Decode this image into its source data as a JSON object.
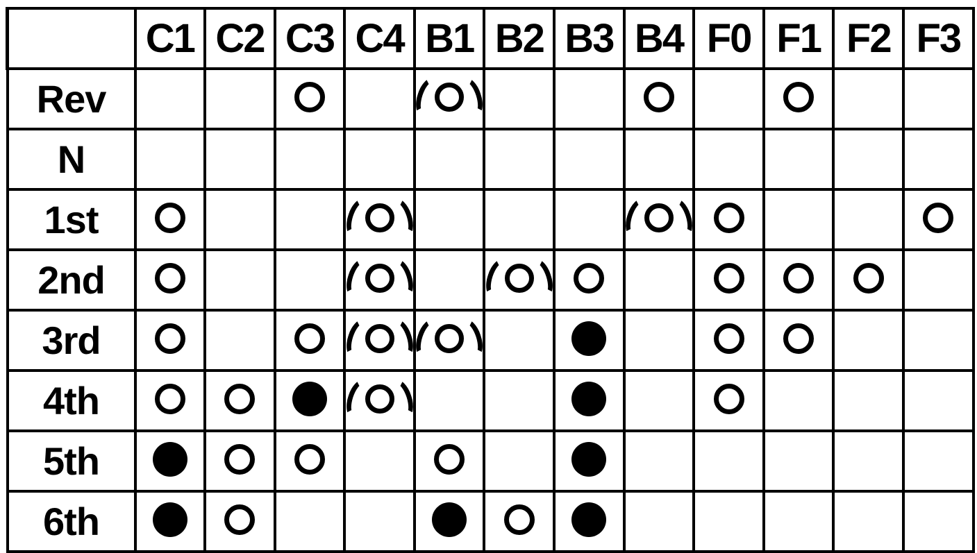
{
  "table": {
    "corner_label": "",
    "columns": [
      "C1",
      "C2",
      "C3",
      "C4",
      "B1",
      "B2",
      "B3",
      "B4",
      "F0",
      "F1",
      "F2",
      "F3"
    ],
    "row_labels": [
      "Rev",
      "N",
      "1st",
      "2nd",
      "3rd",
      "4th",
      "5th",
      "6th"
    ],
    "marker_legend": {
      "open": "open-circle",
      "filled": "filled-circle",
      "paren": "parenthesized-open-circle",
      "empty": "blank"
    },
    "colors": {
      "line": "#000000",
      "background": "#ffffff",
      "text": "#000000"
    },
    "rows": [
      {
        "label": "Rev",
        "cells": [
          "empty",
          "empty",
          "open",
          "empty",
          "paren",
          "empty",
          "empty",
          "open",
          "empty",
          "open",
          "empty",
          "empty"
        ]
      },
      {
        "label": "N",
        "cells": [
          "empty",
          "empty",
          "empty",
          "empty",
          "empty",
          "empty",
          "empty",
          "empty",
          "empty",
          "empty",
          "empty",
          "empty"
        ]
      },
      {
        "label": "1st",
        "cells": [
          "open",
          "empty",
          "empty",
          "paren",
          "empty",
          "empty",
          "empty",
          "paren",
          "open",
          "empty",
          "empty",
          "open"
        ]
      },
      {
        "label": "2nd",
        "cells": [
          "open",
          "empty",
          "empty",
          "paren",
          "empty",
          "paren",
          "open",
          "empty",
          "open",
          "open",
          "open",
          "empty"
        ]
      },
      {
        "label": "3rd",
        "cells": [
          "open",
          "empty",
          "open",
          "paren",
          "paren",
          "empty",
          "filled",
          "empty",
          "open",
          "open",
          "empty",
          "empty"
        ]
      },
      {
        "label": "4th",
        "cells": [
          "open",
          "open",
          "filled",
          "paren",
          "empty",
          "empty",
          "filled",
          "empty",
          "open",
          "empty",
          "empty",
          "empty"
        ]
      },
      {
        "label": "5th",
        "cells": [
          "filled",
          "open",
          "open",
          "empty",
          "open",
          "empty",
          "filled",
          "empty",
          "empty",
          "empty",
          "empty",
          "empty"
        ]
      },
      {
        "label": "6th",
        "cells": [
          "filled",
          "open",
          "empty",
          "empty",
          "filled",
          "open",
          "filled",
          "empty",
          "empty",
          "empty",
          "empty",
          "empty"
        ]
      }
    ]
  }
}
